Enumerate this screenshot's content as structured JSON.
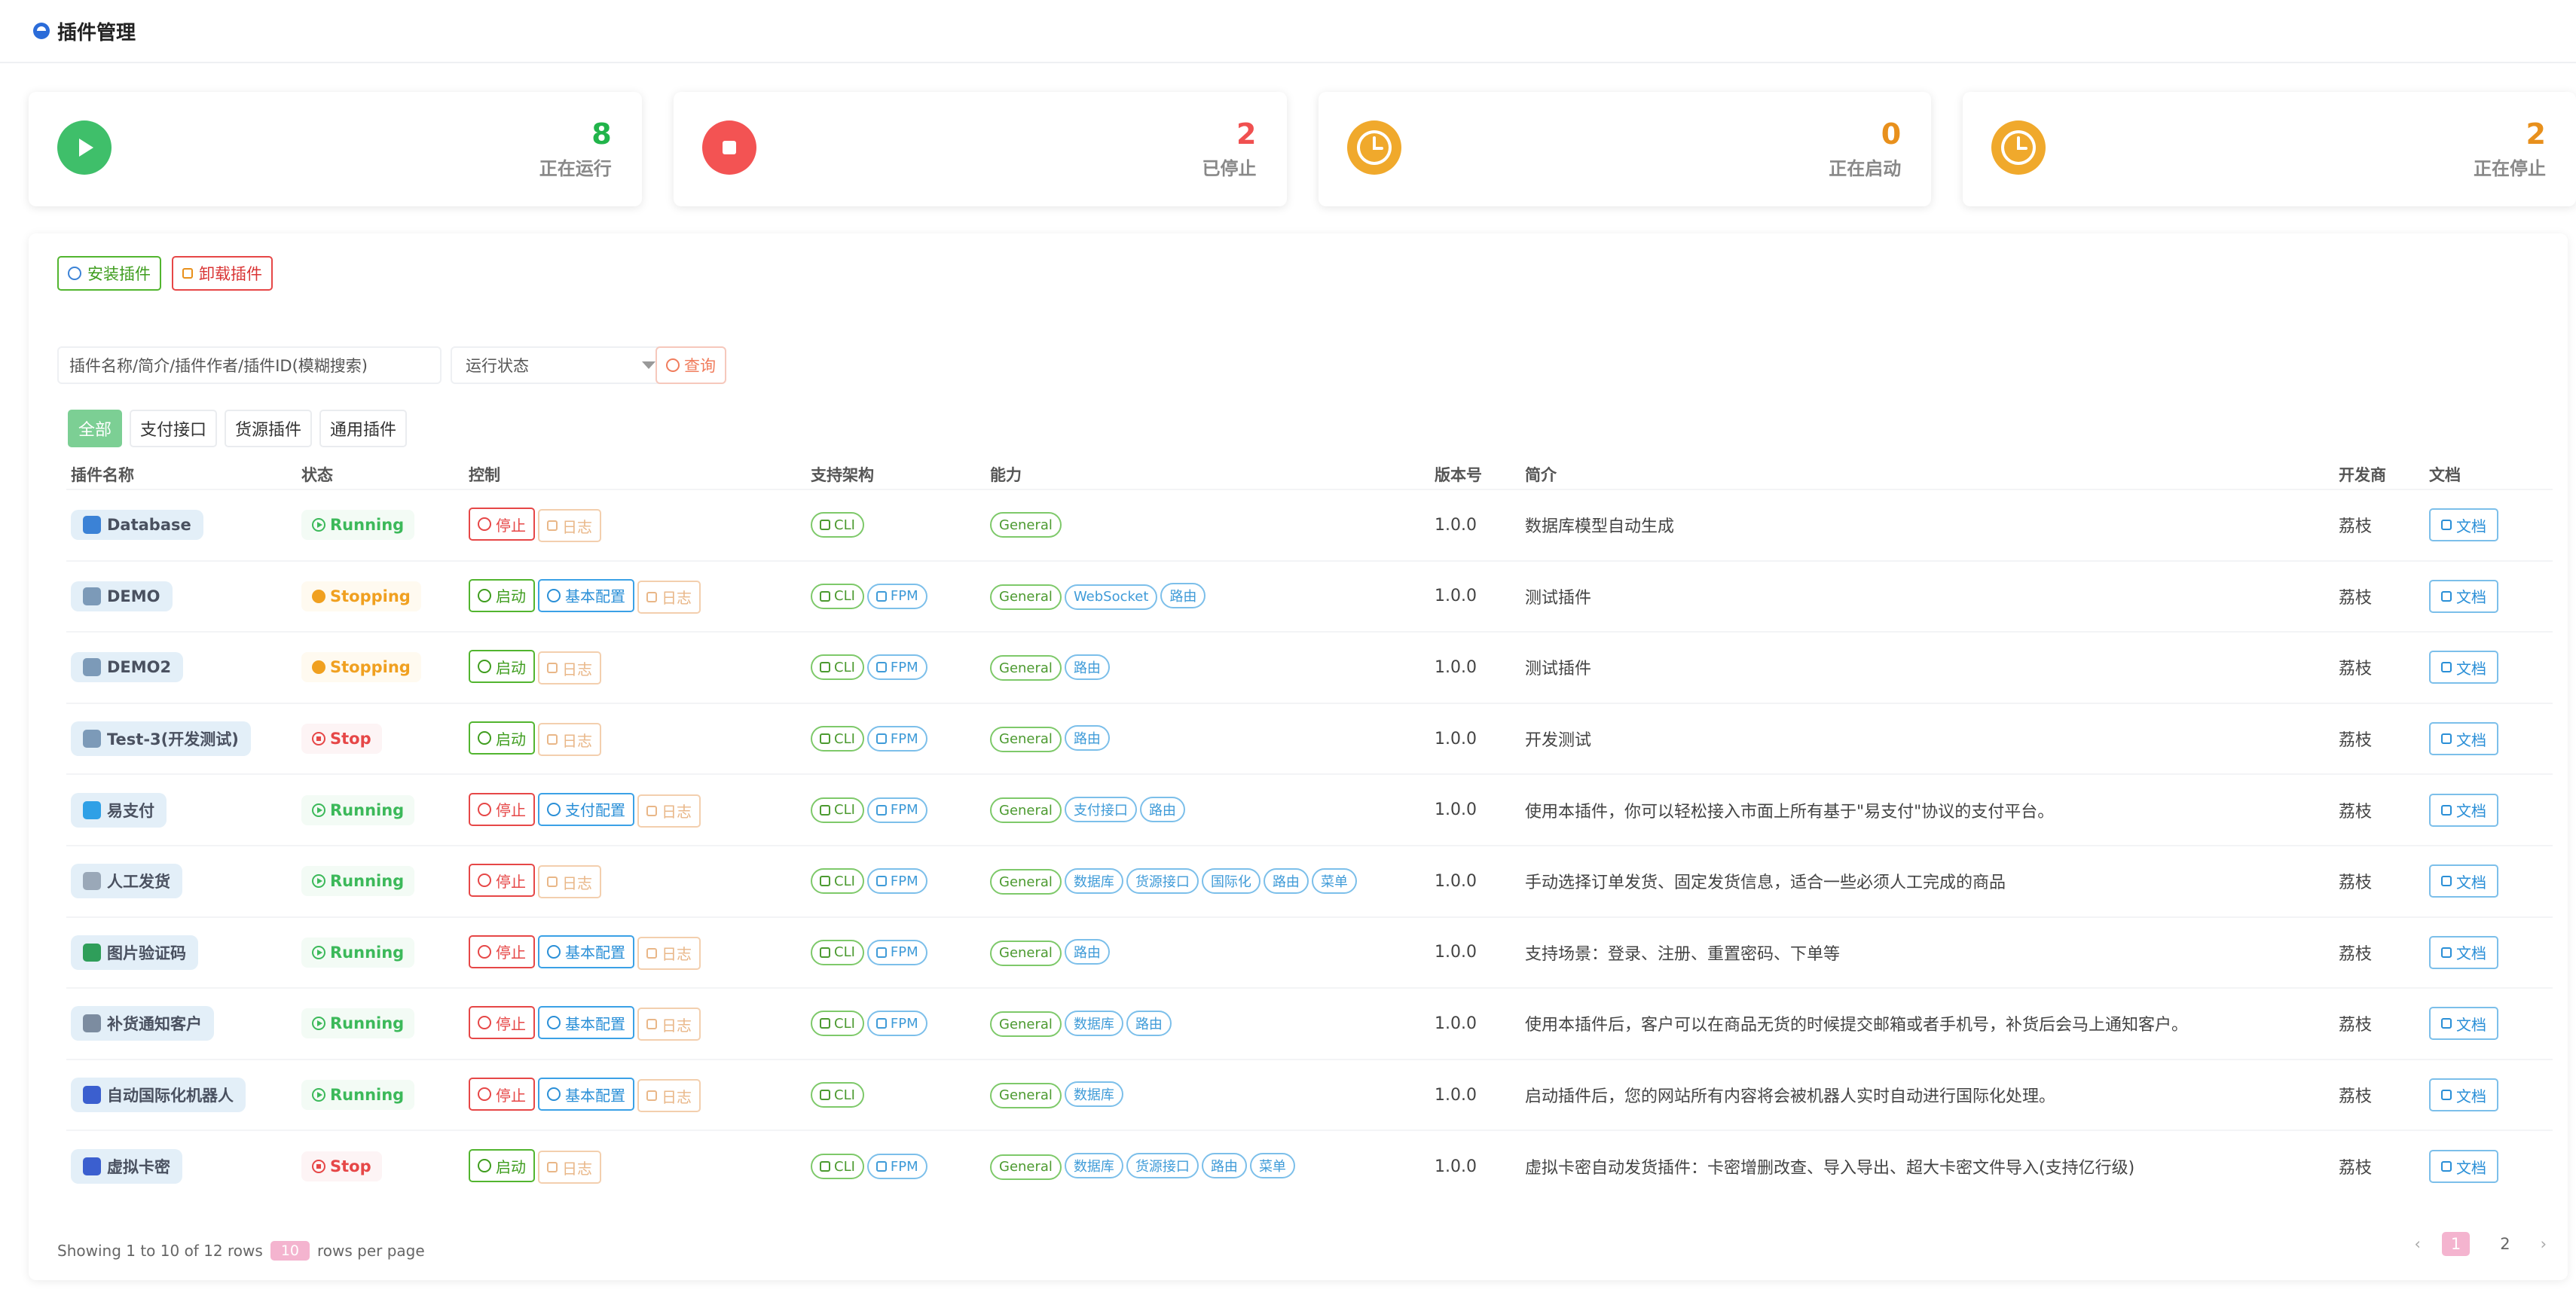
{
  "page": {
    "title": "插件管理"
  },
  "stats": [
    {
      "value": "8",
      "label": "正在运行",
      "color": "#21b44a",
      "icon": "play-icon"
    },
    {
      "value": "2",
      "label": "已停止",
      "color": "#f05050",
      "icon": "stop-icon"
    },
    {
      "value": "0",
      "label": "正在启动",
      "color": "#e8901c",
      "icon": "clock-icon"
    },
    {
      "value": "2",
      "label": "正在停止",
      "color": "#e8901c",
      "icon": "clock-icon"
    }
  ],
  "toolbar": {
    "install": "安装插件",
    "uninstall": "卸载插件"
  },
  "search": {
    "placeholder": "插件名称/简介/插件作者/插件ID(模糊搜索)",
    "status_placeholder": "运行状态",
    "query": "查询"
  },
  "categories": [
    "全部",
    "支付接口",
    "货源插件",
    "通用插件"
  ],
  "table": {
    "headers": [
      "插件名称",
      "状态",
      "控制",
      "支持架构",
      "能力",
      "版本号",
      "简介",
      "开发商",
      "文档"
    ],
    "rows": [
      {
        "name": "Database",
        "status": "Running",
        "controls": [
          "停止",
          "日志"
        ],
        "arch": [
          "CLI"
        ],
        "abilities": [
          "General"
        ],
        "version": "1.0.0",
        "desc": "数据库模型自动生成",
        "vendor": "荔枝",
        "doc": "文档"
      },
      {
        "name": "DEMO",
        "status": "Stopping",
        "controls": [
          "启动",
          "基本配置",
          "日志"
        ],
        "arch": [
          "CLI",
          "FPM"
        ],
        "abilities": [
          "General",
          "WebSocket",
          "路由"
        ],
        "version": "1.0.0",
        "desc": "测试插件",
        "vendor": "荔枝",
        "doc": "文档"
      },
      {
        "name": "DEMO2",
        "status": "Stopping",
        "controls": [
          "启动",
          "日志"
        ],
        "arch": [
          "CLI",
          "FPM"
        ],
        "abilities": [
          "General",
          "路由"
        ],
        "version": "1.0.0",
        "desc": "测试插件",
        "vendor": "荔枝",
        "doc": "文档"
      },
      {
        "name": "Test-3(开发测试)",
        "status": "Stop",
        "controls": [
          "启动",
          "日志"
        ],
        "arch": [
          "CLI",
          "FPM"
        ],
        "abilities": [
          "General",
          "路由"
        ],
        "version": "1.0.0",
        "desc": "开发测试",
        "vendor": "荔枝",
        "doc": "文档"
      },
      {
        "name": "易支付",
        "status": "Running",
        "controls": [
          "停止",
          "支付配置",
          "日志"
        ],
        "arch": [
          "CLI",
          "FPM"
        ],
        "abilities": [
          "General",
          "支付接口",
          "路由"
        ],
        "version": "1.0.0",
        "desc": "使用本插件，你可以轻松接入市面上所有基于\"易支付\"协议的支付平台。",
        "vendor": "荔枝",
        "doc": "文档"
      },
      {
        "name": "人工发货",
        "status": "Running",
        "controls": [
          "停止",
          "日志"
        ],
        "arch": [
          "CLI",
          "FPM"
        ],
        "abilities": [
          "General",
          "数据库",
          "货源接口",
          "国际化",
          "路由",
          "菜单"
        ],
        "version": "1.0.0",
        "desc": "手动选择订单发货、固定发货信息，适合一些必须人工完成的商品",
        "vendor": "荔枝",
        "doc": "文档"
      },
      {
        "name": "图片验证码",
        "status": "Running",
        "controls": [
          "停止",
          "基本配置",
          "日志"
        ],
        "arch": [
          "CLI",
          "FPM"
        ],
        "abilities": [
          "General",
          "路由"
        ],
        "version": "1.0.0",
        "desc": "支持场景：登录、注册、重置密码、下单等",
        "vendor": "荔枝",
        "doc": "文档"
      },
      {
        "name": "补货通知客户",
        "status": "Running",
        "controls": [
          "停止",
          "基本配置",
          "日志"
        ],
        "arch": [
          "CLI",
          "FPM"
        ],
        "abilities": [
          "General",
          "数据库",
          "路由"
        ],
        "version": "1.0.0",
        "desc": "使用本插件后，客户可以在商品无货的时候提交邮箱或者手机号，补货后会马上通知客户。",
        "vendor": "荔枝",
        "doc": "文档"
      },
      {
        "name": "自动国际化机器人",
        "status": "Running",
        "controls": [
          "停止",
          "基本配置",
          "日志"
        ],
        "arch": [
          "CLI"
        ],
        "abilities": [
          "General",
          "数据库"
        ],
        "version": "1.0.0",
        "desc": "启动插件后，您的网站所有内容将会被机器人实时自动进行国际化处理。",
        "vendor": "荔枝",
        "doc": "文档"
      },
      {
        "name": "虚拟卡密",
        "status": "Stop",
        "controls": [
          "启动",
          "日志"
        ],
        "arch": [
          "CLI",
          "FPM"
        ],
        "abilities": [
          "General",
          "数据库",
          "货源接口",
          "路由",
          "菜单"
        ],
        "version": "1.0.0",
        "desc": "虚拟卡密自动发货插件：卡密增删改查、导入导出、超大卡密文件导入(支持亿行级)",
        "vendor": "荔枝",
        "doc": "文档"
      }
    ]
  },
  "pagination": {
    "info_prefix": "Showing 1 to 10 of 12 rows",
    "per_page": "10",
    "info_suffix": "rows per page",
    "pages": [
      "1",
      "2"
    ],
    "prev": "‹",
    "next": "›"
  }
}
